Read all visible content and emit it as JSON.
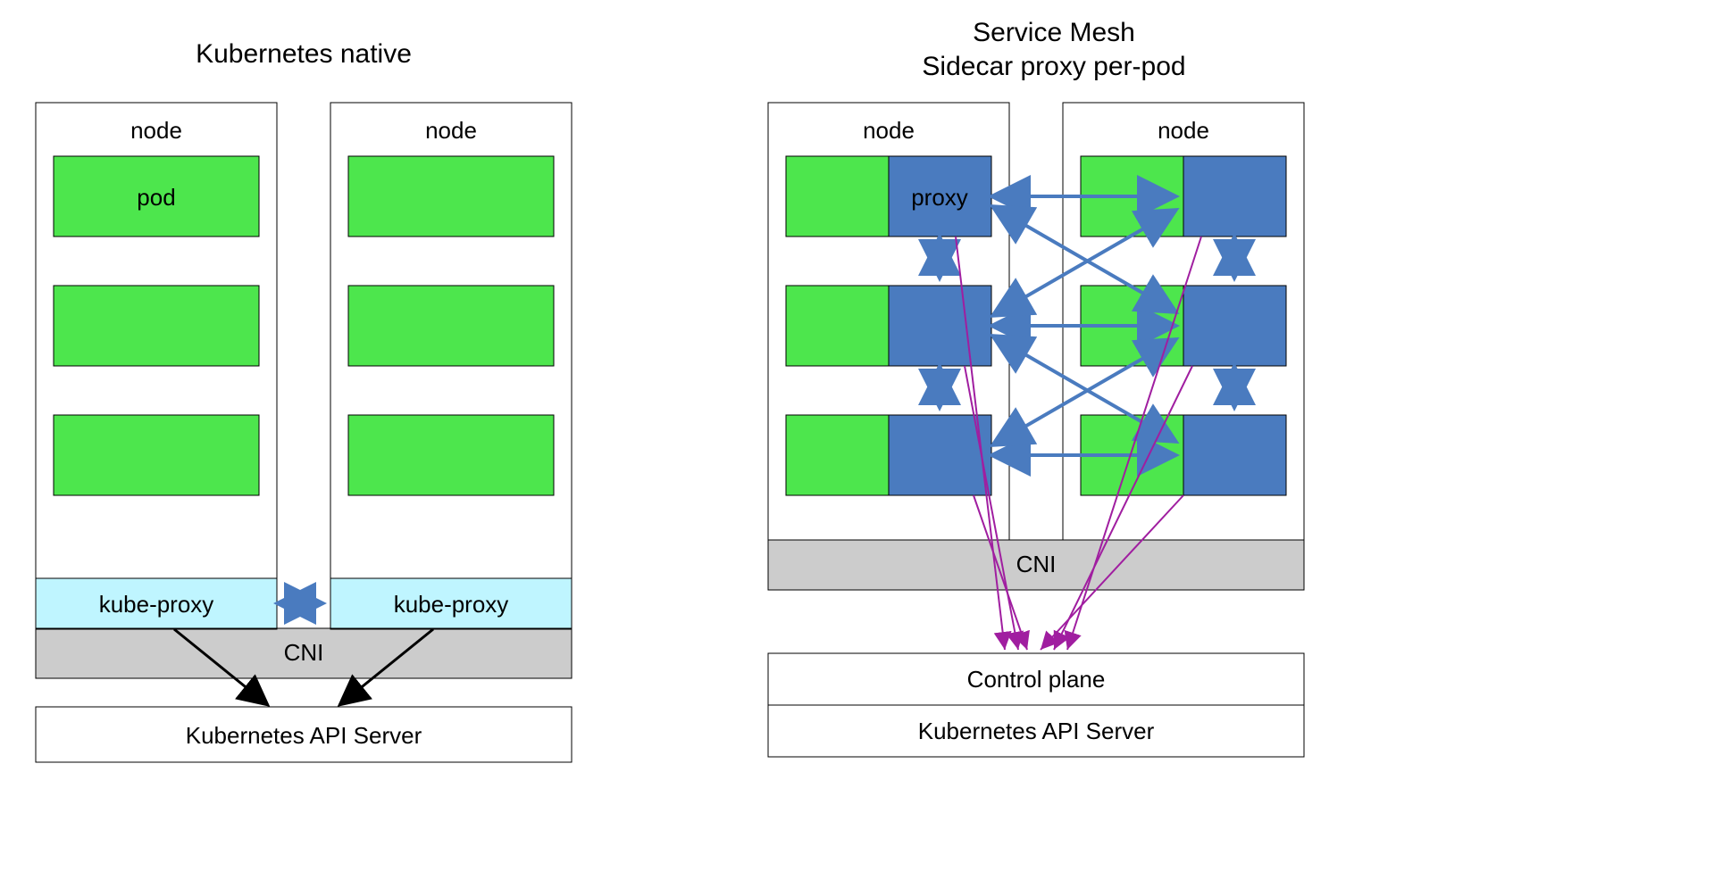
{
  "left": {
    "title": "Kubernetes native",
    "node_label": "node",
    "pod_label": "pod",
    "cni_label": "CNI",
    "kube_proxy_label": "kube-proxy",
    "api_server_label": "Kubernetes API Server"
  },
  "right": {
    "title_line1": "Service Mesh",
    "title_line2": "Sidecar proxy per-pod",
    "node_label": "node",
    "proxy_label": "proxy",
    "cni_label": "CNI",
    "control_plane_label": "Control plane",
    "api_server_label": "Kubernetes API Server"
  },
  "colors": {
    "pod_green": "#4de64d",
    "proxy_blue": "#4a7bbf",
    "kubeproxy_fill": "#bff5ff",
    "cni_fill": "#cccccc",
    "arrow_blue": "#4a7bbf",
    "arrow_black": "#000000",
    "arrow_magenta": "#a01ea0",
    "border": "#000000"
  }
}
